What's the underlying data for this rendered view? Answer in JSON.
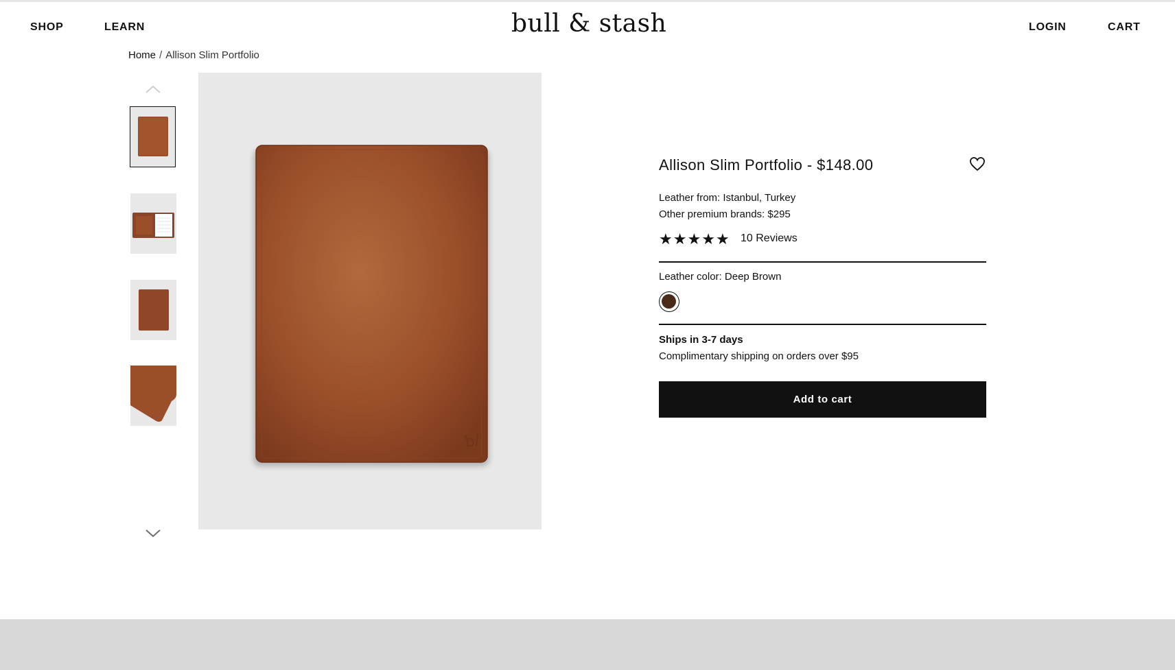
{
  "nav": {
    "shop": "SHOP",
    "learn": "LEARN",
    "logo": "bull & stash",
    "login": "LOGIN",
    "cart": "CART"
  },
  "breadcrumb": {
    "home": "Home",
    "separator": "/",
    "current": "Allison Slim Portfolio"
  },
  "gallery": {
    "thumbnails": [
      {
        "view": "front",
        "selected": true
      },
      {
        "view": "open-with-notepad",
        "selected": false
      },
      {
        "view": "back",
        "selected": false
      },
      {
        "view": "corner-detail",
        "selected": false
      }
    ],
    "up_icon": "chevron-up-icon",
    "down_icon": "chevron-down-icon"
  },
  "product": {
    "title": "Allison Slim Portfolio - $148.00",
    "leather_from": "Leather from: Istanbul, Turkey",
    "other_brands": "Other premium brands: $295",
    "rating": 5,
    "reviews": "10 Reviews",
    "leather_color_label": "Leather color: Deep Brown",
    "swatch_color": "#4a2a18",
    "ships": "Ships in 3-7 days",
    "shipping_note": "Complimentary shipping on orders over $95",
    "add_to_cart": "Add to cart",
    "favorite_icon": "heart-icon"
  },
  "colors": {
    "leather": "#9a4f2a",
    "button_bg": "#111111",
    "image_bg": "#e8e8e8",
    "footer_band": "#d8d8d8"
  }
}
